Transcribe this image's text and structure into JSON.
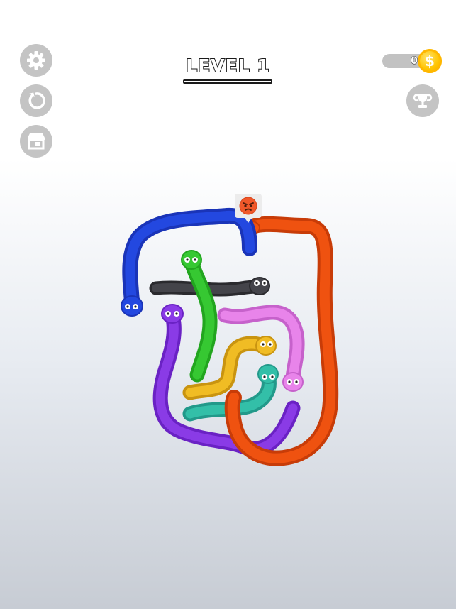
{
  "header": {
    "level_title": "LEVEL 1"
  },
  "wallet": {
    "coins": "0",
    "coin_symbol": "$"
  },
  "left_buttons": [
    {
      "icon": "gear-icon"
    },
    {
      "icon": "restart-icon"
    },
    {
      "icon": "shop-icon"
    }
  ],
  "right_buttons": [
    {
      "icon": "trophy-icon"
    }
  ],
  "colors": {
    "button_gray": "#c4c4c4",
    "coin_gold": "#ffc400",
    "snake_blue": "#1f3fd8",
    "snake_orange": "#ec4c0e",
    "snake_green": "#2fc02a",
    "snake_black": "#3a3a3e",
    "snake_pink": "#e37ce6",
    "snake_yellow": "#ecb51b",
    "snake_teal": "#2ab6a0",
    "snake_purple": "#7a2bd8"
  },
  "snakes": [
    {
      "name": "blue",
      "color": "#1f3fd8"
    },
    {
      "name": "orange",
      "color": "#ec4c0e"
    },
    {
      "name": "black",
      "color": "#3a3a3e"
    },
    {
      "name": "green",
      "color": "#2fc02a"
    },
    {
      "name": "purple",
      "color": "#7a2bd8"
    },
    {
      "name": "pink",
      "color": "#e37ce6"
    },
    {
      "name": "yellow",
      "color": "#ecb51b"
    },
    {
      "name": "teal",
      "color": "#2ab6a0"
    }
  ],
  "emotion_badge": {
    "icon": "angry-face-icon"
  }
}
